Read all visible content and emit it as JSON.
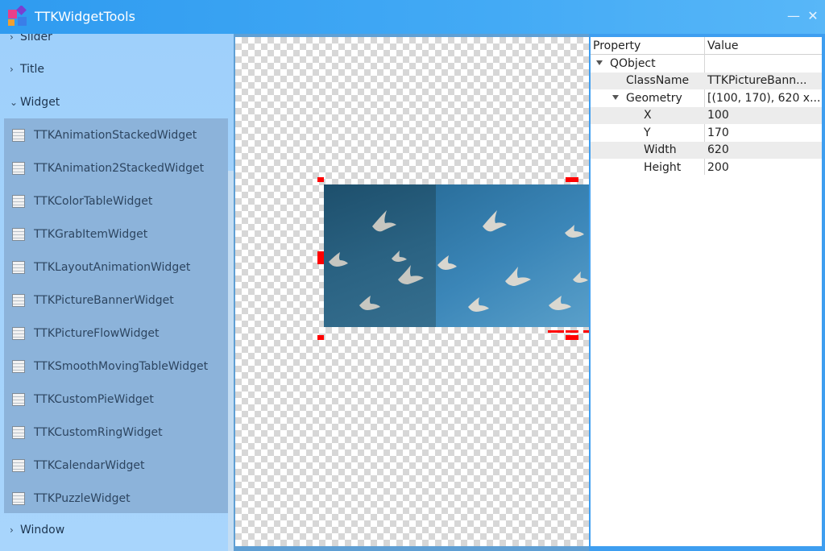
{
  "window": {
    "title": "TTKWidgetTools",
    "minimize_glyph": "—",
    "close_glyph": "✕"
  },
  "sidebar": {
    "groups": [
      {
        "label": "Slider",
        "expanded": false
      },
      {
        "label": "Title",
        "expanded": false
      },
      {
        "label": "Widget",
        "expanded": true
      },
      {
        "label": "Window",
        "expanded": false
      }
    ],
    "widget_items": [
      "TTKAnimationStackedWidget",
      "TTKAnimation2StackedWidget",
      "TTKColorTableWidget",
      "TTKGrabItemWidget",
      "TTKLayoutAnimationWidget",
      "TTKPictureBannerWidget",
      "TTKPictureFlowWidget",
      "TTKSmoothMovingTableWidget",
      "TTKCustomPieWidget",
      "TTKCustomRingWidget",
      "TTKCalendarWidget",
      "TTKPuzzleWidget"
    ],
    "item_icon": "list-widget-icon",
    "colors": {
      "item_bg": "#8cb3da",
      "text": "#2d4560"
    }
  },
  "properties": {
    "headers": {
      "property": "Property",
      "value": "Value"
    },
    "rows": [
      {
        "name": "QObject",
        "value": ""
      },
      {
        "name": "ClassName",
        "value": "TTKPictureBann..."
      },
      {
        "name": "Geometry",
        "value": "[(100, 170), 620 x..."
      },
      {
        "name": "X",
        "value": "100"
      },
      {
        "name": "Y",
        "value": "170"
      },
      {
        "name": "Width",
        "value": "620"
      },
      {
        "name": "Height",
        "value": "200"
      }
    ]
  },
  "colors": {
    "titlebar": "#3ea2f2",
    "selection_handle": "#ff0000"
  }
}
